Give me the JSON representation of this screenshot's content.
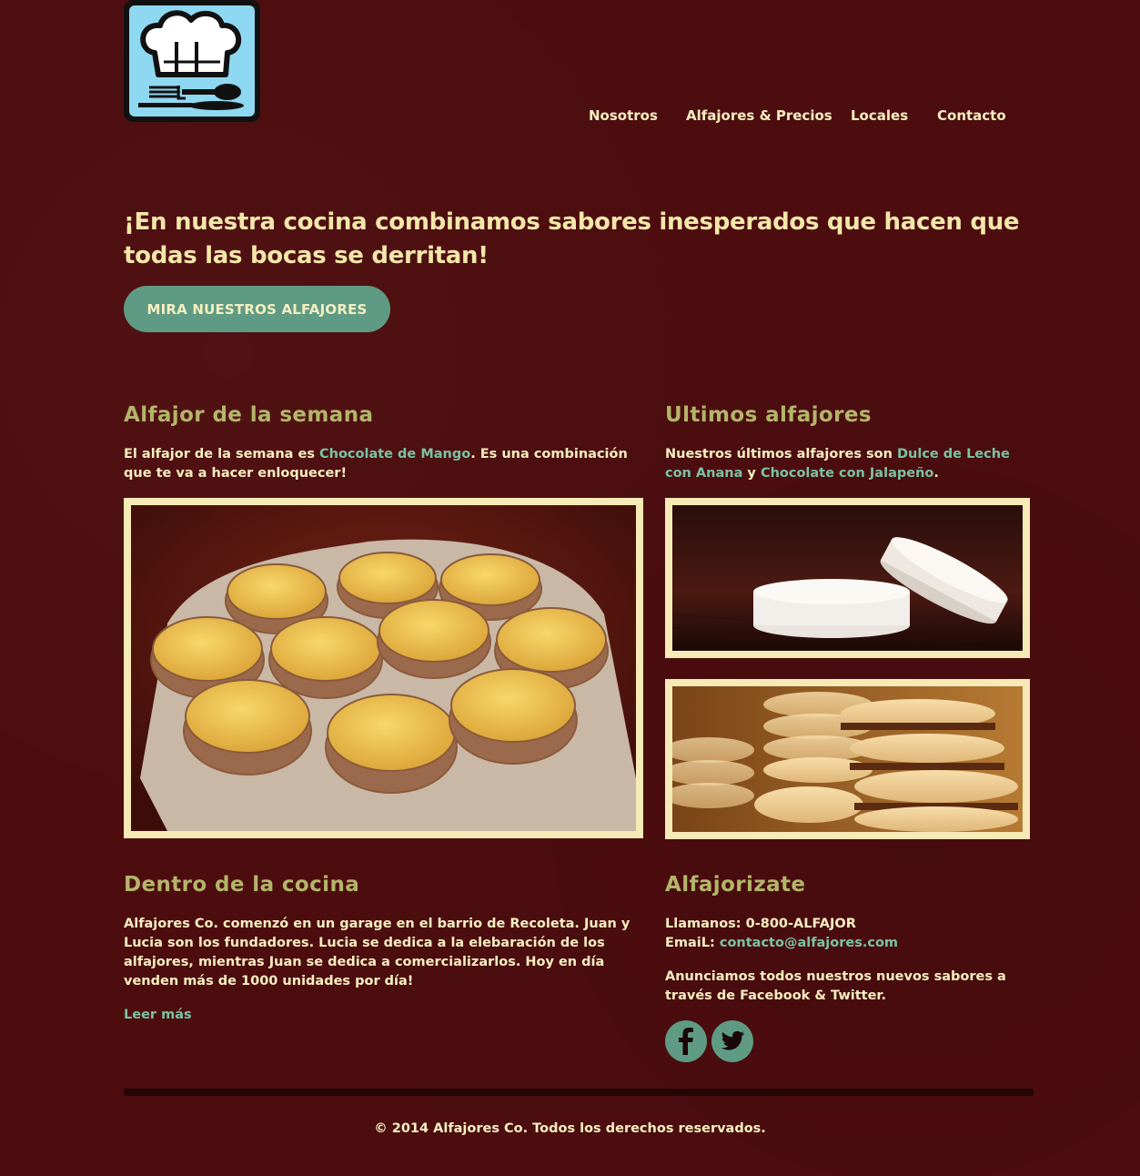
{
  "header": {
    "logo_icon": "chef-hat-cutlery-icon",
    "nav": [
      "Nosotros",
      "Alfajores & Precios",
      "Locales",
      "Contacto"
    ]
  },
  "hero": {
    "title": "¡En nuestra cocina combinamos sabores inesperados que hacen que todas las bocas se derritan!",
    "cta": "MIRA NUESTROS ALFAJORES"
  },
  "week": {
    "heading": "Alfajor de la semana",
    "text_before": "El alfajor de la semana es ",
    "link": "Chocolate de Mango",
    "text_after": ". Es una combinación que te va a hacer enloquecer!"
  },
  "latest": {
    "heading": "Ultimos alfajores",
    "text_before": "Nuestros últimos alfajores son ",
    "link1": "Dulce de Leche con Anana",
    "text_mid": " y ",
    "link2": "Chocolate con Jalapeño",
    "text_after": "."
  },
  "kitchen": {
    "heading": "Dentro de la cocina",
    "text": "Alfajores Co. comenzó en un garage en el barrio de Recoleta. Juan y Lucia son los fundadores. Lucia se dedica a la elebaración de los alfajores, mientras Juan se dedica a comercializarlos. Hoy en día venden más de 1000 unidades por día!",
    "more": "Leer más"
  },
  "contact": {
    "heading": "Alfajorizate",
    "phone": "Llamanos: 0-800-ALFAJOR",
    "email_label": "EmaiL: ",
    "email": "contacto@alfajores.com",
    "social_text": "Anunciamos todos nuestros nuevos sabores a través de Facebook & Twitter.",
    "icons": [
      "facebook-icon",
      "twitter-icon"
    ]
  },
  "footer": {
    "text": "© 2014 Alfajores Co. Todos los derechos reservados."
  },
  "colors": {
    "background": "#4d0d0f",
    "accent": "#5f9b84",
    "heading": "#b3b56a",
    "text": "#f7eec0",
    "link": "#79c3a3"
  }
}
